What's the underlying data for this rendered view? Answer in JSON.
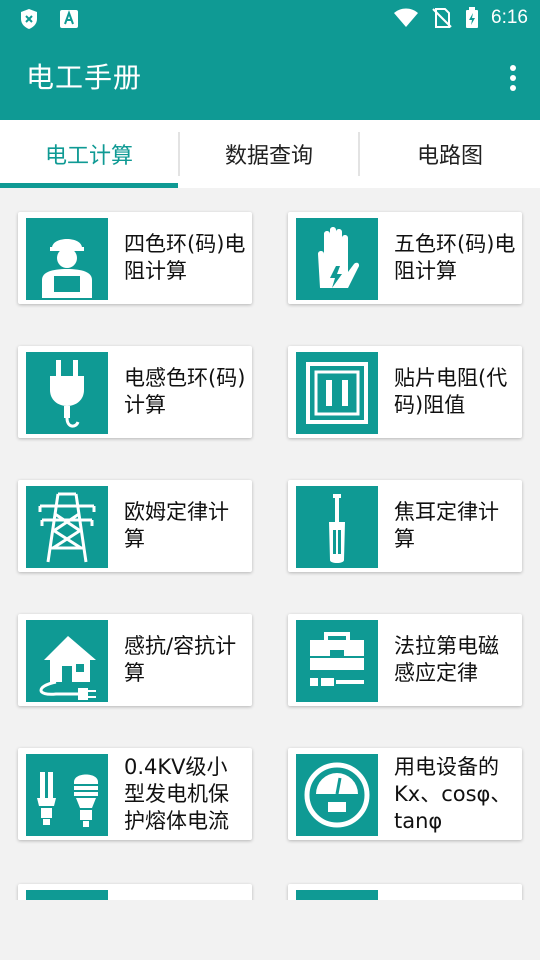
{
  "status_bar": {
    "time": "6:16",
    "left_icons": [
      "shield-x-icon",
      "accessibility-icon"
    ],
    "right_icons": [
      "wifi-icon",
      "no-sim-icon",
      "battery-charging-icon"
    ]
  },
  "app_bar": {
    "title": "电工手册",
    "menu_icon": "more-vertical-icon"
  },
  "tabs": [
    {
      "label": "电工计算",
      "active": true
    },
    {
      "label": "数据查询",
      "active": false
    },
    {
      "label": "电路图",
      "active": false
    }
  ],
  "cards": [
    {
      "label": "四色环(码)电阻计算",
      "icon": "worker-icon"
    },
    {
      "label": "五色环(码)电阻计算",
      "icon": "glove-icon"
    },
    {
      "label": "电感色环(码)计算",
      "icon": "plug-icon"
    },
    {
      "label": "贴片电阻(代码)阻值",
      "icon": "socket-icon"
    },
    {
      "label": "欧姆定律计算",
      "icon": "tower-icon"
    },
    {
      "label": "焦耳定律计算",
      "icon": "screwdriver-icon"
    },
    {
      "label": "感抗/容抗计算",
      "icon": "house-plug-icon"
    },
    {
      "label": "法拉第电磁感应定律",
      "icon": "toolbox-icon"
    },
    {
      "label": "0.4KV级小型发电机保护熔体电流",
      "icon": "bulbs-icon"
    },
    {
      "label": "用电设备的Kx、cosφ、tanφ",
      "icon": "meter-icon"
    },
    {
      "label": "",
      "icon": "partial-icon"
    },
    {
      "label": "",
      "icon": "partial-icon"
    }
  ],
  "colors": {
    "primary": "#0f9a94",
    "background": "#f2f2f2"
  }
}
